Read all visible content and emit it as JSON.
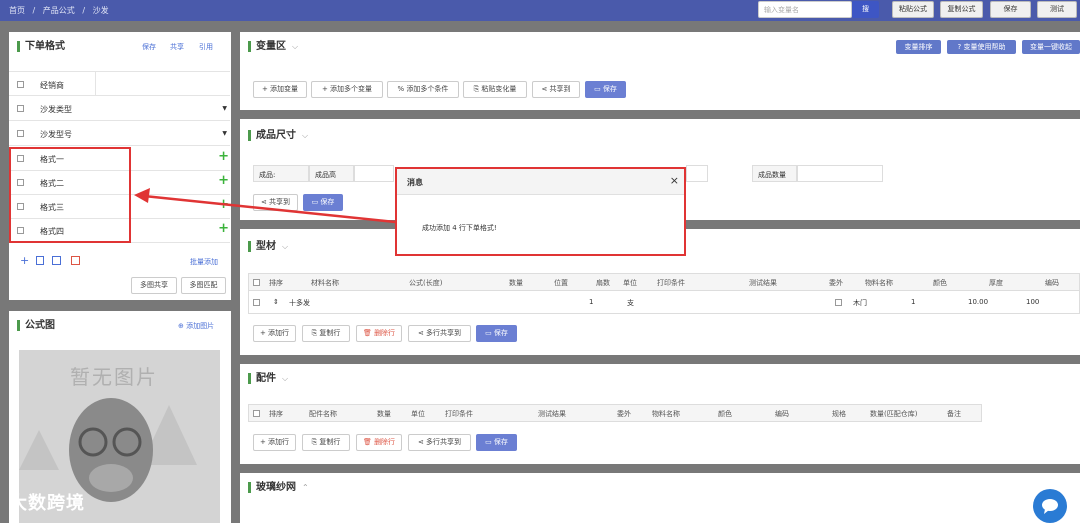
{
  "breadcrumb": [
    "首页",
    "/",
    "产品公式",
    "/",
    "沙发"
  ],
  "topbar": {
    "search_placeholder": "输入变量名",
    "search_btn": "搜",
    "paste_formula": "粘贴公式",
    "copy_formula": "复制公式",
    "save": "保存",
    "test": "测试"
  },
  "order_format": {
    "title": "下单格式",
    "actions": [
      "保存",
      "共享",
      "引用"
    ],
    "rows": [
      {
        "label": "经销商",
        "control": "none"
      },
      {
        "label": "沙发类型",
        "control": "dropdown"
      },
      {
        "label": "沙发型号",
        "control": "dropdown"
      },
      {
        "label": "格式一",
        "control": "plus"
      },
      {
        "label": "格式二",
        "control": "plus"
      },
      {
        "label": "格式三",
        "control": "plus"
      },
      {
        "label": "格式四",
        "control": "plus"
      }
    ],
    "batch_add": "批量添加",
    "multi_share": "多图共享",
    "multi_match": "多图匹配"
  },
  "formula_image": {
    "title": "公式图",
    "add_image": "添加图片",
    "placeholder": "暂无图片"
  },
  "variables": {
    "title": "变量区",
    "tags": [
      "变量排序",
      "? 变量使用帮助",
      "变量一键收起"
    ],
    "buttons": [
      "添加变量",
      "添加多个变量",
      "添加多个条件",
      "粘贴变化量",
      "共享到",
      "保存"
    ]
  },
  "finished_size": {
    "title": "成品尺寸",
    "field1_label": "成品:",
    "field2_label": "成品高",
    "field3_label": "成品数量",
    "share": "共享到",
    "save": "保存"
  },
  "profile": {
    "title": "型材",
    "headers": [
      "排序",
      "材料名称",
      "公式(长度)",
      "数量",
      "位置",
      "扇数",
      "单位",
      "打印条件",
      "测试结果",
      "委外",
      "物料名称",
      "颜色",
      "厚度",
      "编码"
    ],
    "row": {
      "name": "十多发",
      "fan": "1",
      "unit": "支",
      "material": "木门",
      "color": "1",
      "thickness": "10.00",
      "code": "100"
    },
    "buttons": [
      "添加行",
      "复制行",
      "删除行",
      "多行共享到",
      "保存"
    ]
  },
  "accessories": {
    "title": "配件",
    "headers": [
      "排序",
      "配件名称",
      "数量",
      "单位",
      "打印条件",
      "测试结果",
      "委外",
      "物料名称",
      "颜色",
      "编码",
      "规格",
      "数量(匹配仓库)",
      "备注"
    ],
    "buttons": [
      "添加行",
      "复制行",
      "删除行",
      "多行共享到",
      "保存"
    ]
  },
  "glass": {
    "title": "玻璃纱网"
  },
  "modal": {
    "title": "消息",
    "close": "×",
    "message": "成功添加 4 行下单格式!"
  },
  "watermark": "大数跨境",
  "colors": {
    "accent": "#4a5aab",
    "highlight": "#e03434",
    "add": "#3bb33b"
  }
}
